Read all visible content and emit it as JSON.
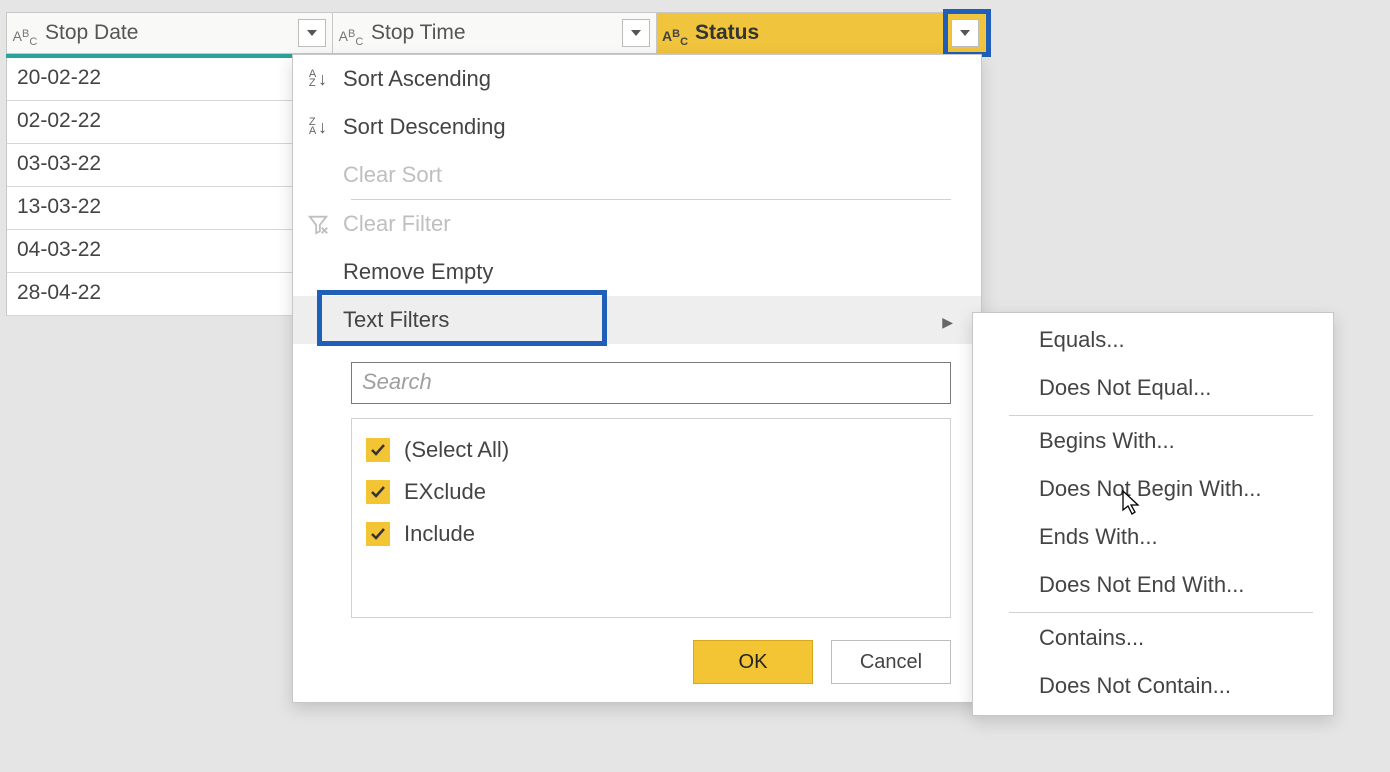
{
  "columns": [
    {
      "name": "Stop Date"
    },
    {
      "name": "Stop Time"
    },
    {
      "name": "Status"
    }
  ],
  "rows": [
    "20-02-22",
    "02-02-22",
    "03-03-22",
    "13-03-22",
    "04-03-22",
    "28-04-22"
  ],
  "menu": {
    "sort_asc": "Sort Ascending",
    "sort_desc": "Sort Descending",
    "clear_sort": "Clear Sort",
    "clear_filter": "Clear Filter",
    "remove_empty": "Remove Empty",
    "text_filters": "Text Filters",
    "search_placeholder": "Search",
    "options": [
      {
        "label": "(Select All)",
        "checked": true
      },
      {
        "label": "EXclude",
        "checked": true
      },
      {
        "label": "Include",
        "checked": true
      }
    ],
    "ok": "OK",
    "cancel": "Cancel"
  },
  "submenu": {
    "equals": "Equals...",
    "does_not_equal": "Does Not Equal...",
    "begins_with": "Begins With...",
    "does_not_begin_with": "Does Not Begin With...",
    "ends_with": "Ends With...",
    "does_not_end_with": "Does Not End With...",
    "contains": "Contains...",
    "does_not_contain": "Does Not Contain..."
  }
}
